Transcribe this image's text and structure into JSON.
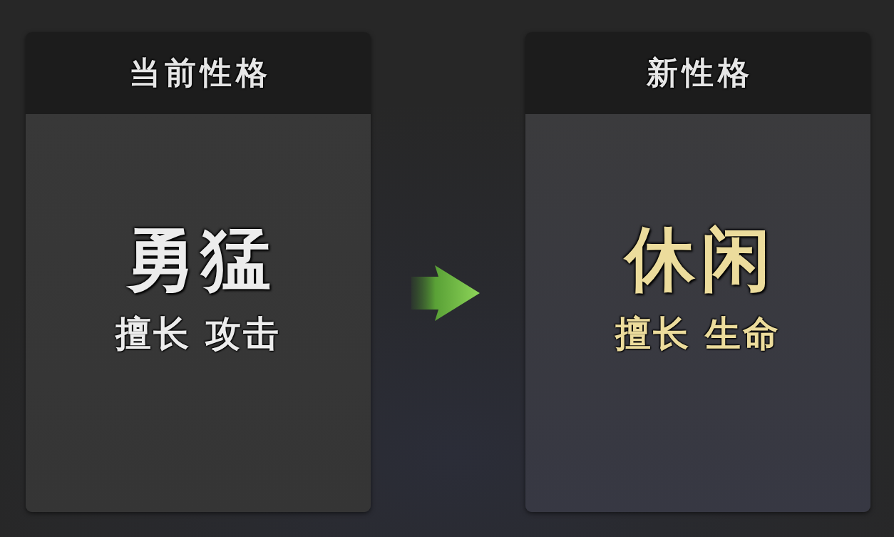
{
  "panels": [
    {
      "kind": "current",
      "title": "当前性格",
      "name": "勇猛",
      "specialty": "擅长 攻击"
    },
    {
      "kind": "new",
      "title": "新性格",
      "name": "休闲",
      "specialty": "擅长 生命"
    }
  ]
}
